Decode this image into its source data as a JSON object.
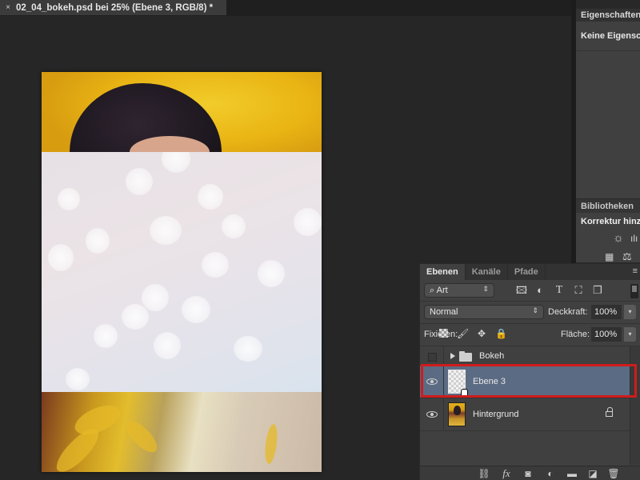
{
  "document_tab": {
    "close_glyph": "×",
    "title": "02_04_bokeh.psd bei 25% (Ebene 3, RGB/8) *"
  },
  "properties_panel": {
    "tab_label": "Eigenschaften",
    "message": "Keine Eigenschaften"
  },
  "libraries_panel": {
    "tab_label": "Bibliotheken",
    "heading": "Korrektur hinzufügen",
    "icons": [
      "brightness-contrast-icon",
      "levels-icon",
      "gradient-map-icon",
      "balance-icon"
    ]
  },
  "layers_panel": {
    "tabs": [
      {
        "label": "Ebenen",
        "active": true
      },
      {
        "label": "Kanäle",
        "active": false
      },
      {
        "label": "Pfade",
        "active": false
      }
    ],
    "menu_glyph": "≡",
    "filter": {
      "search_glyph": "⌕",
      "kind_value": "Art",
      "arrows_glyph": "⇕",
      "icons": [
        "pixel-layer-filter-icon",
        "adjustment-layer-filter-icon",
        "type-layer-filter-icon",
        "shape-layer-filter-icon",
        "smart-object-filter-icon"
      ]
    },
    "blend_mode": "Normal",
    "opacity_label": "Deckkraft:",
    "opacity_value": "100%",
    "lock_label": "Fixieren:",
    "fill_label": "Fläche:",
    "fill_value": "100%",
    "dropdown_glyph": "▾",
    "layers": [
      {
        "name": "Bokeh",
        "type": "group",
        "visible": false,
        "selected": false,
        "locked": false
      },
      {
        "name": "Ebene 3",
        "type": "pixel",
        "visible": true,
        "selected": true,
        "locked": false
      },
      {
        "name": "Hintergrund",
        "type": "background",
        "visible": true,
        "selected": false,
        "locked": true
      }
    ],
    "bottom_icons": [
      "link-layers-icon",
      "fx-icon",
      "add-mask-icon",
      "new-adjustment-icon",
      "new-group-icon",
      "new-layer-icon",
      "delete-layer-icon"
    ],
    "fx_label": "fx",
    "highlight_color": "#d01c1c",
    "selected_row_color": "#5b6b83"
  }
}
